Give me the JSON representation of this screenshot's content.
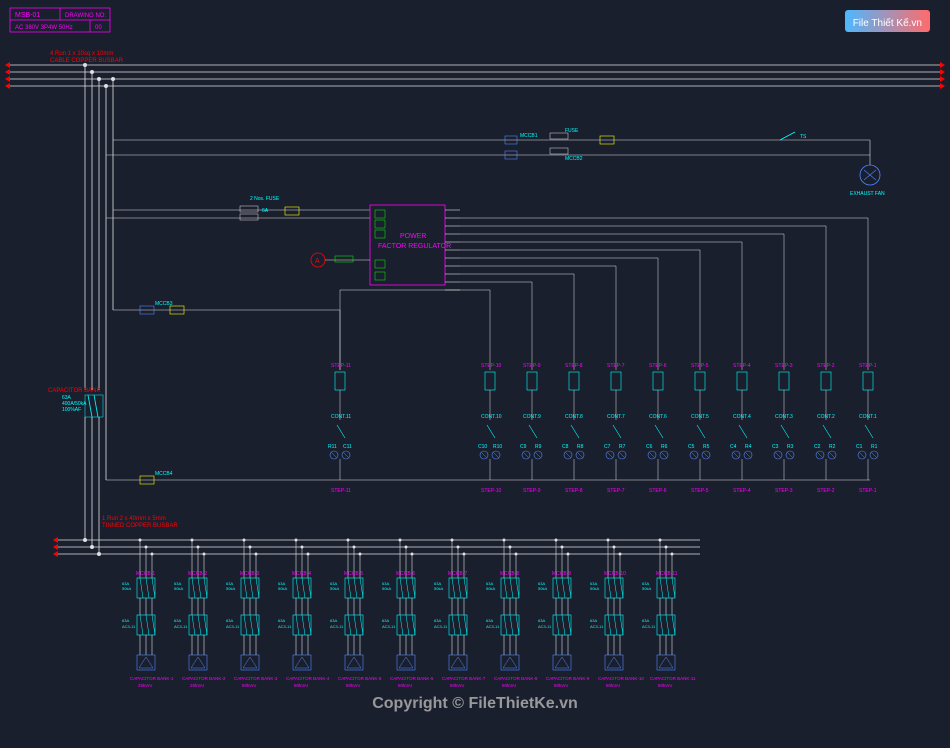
{
  "logo": {
    "main": "File Thiết Kế",
    "suffix": ".vn"
  },
  "copyright": "Copyright © FileThietKe.vn",
  "titleBlock": {
    "name": "MSB-01",
    "drawing": "DRAWING NO:",
    "spec": "AC 380V 3P4W 50Hz",
    "rev": "00"
  },
  "busLabels": {
    "top": "4 Run 1 x 10sq x 10mm",
    "topSub": "CABLE COPPER BUSBAR",
    "bottom": "1 Run 2 x 40mm x 5mm",
    "bottomSub": "TINNED COPPER BUSBAR"
  },
  "mainBreaker": {
    "label": "CAPACITOR BANK",
    "rating1": "63A",
    "rating2": "400A/50kA",
    "rating3": "100%AF"
  },
  "pfr": {
    "title1": "POWER",
    "title2": "FACTOR REGULATOR",
    "fuseLabel": "2 Nos. FUSE",
    "fuseRating": "6A"
  },
  "auxDevices": {
    "mccb1": "MCCB1",
    "mccb2": "MCCB2",
    "mccb3": "MCCB3",
    "mccb4": "MCCB4",
    "fuse": "FUSE",
    "exhaustFan": "EXHAUST FAN",
    "ts": "TS"
  },
  "capacitorSteps": [
    {
      "id": "step-11",
      "step": "STEP-11",
      "cont": "CONT.11",
      "r": "R11",
      "c": "C11"
    },
    {
      "id": "step-10",
      "step": "STEP-10",
      "cont": "CONT.10",
      "r": "C10",
      "c": "R10"
    },
    {
      "id": "step-9",
      "step": "STEP-9",
      "cont": "CONT.9",
      "r": "C9",
      "c": "R9"
    },
    {
      "id": "step-8",
      "step": "STEP-8",
      "cont": "CONT.8",
      "r": "C8",
      "c": "R8"
    },
    {
      "id": "step-7",
      "step": "STEP-7",
      "cont": "CONT.7",
      "r": "C7",
      "c": "R7"
    },
    {
      "id": "step-6",
      "step": "STEP-6",
      "cont": "CONT.6",
      "r": "C6",
      "c": "R6"
    },
    {
      "id": "step-5",
      "step": "STEP-5",
      "cont": "CONT.5",
      "r": "C5",
      "c": "R5"
    },
    {
      "id": "step-4",
      "step": "STEP-4",
      "cont": "CONT.4",
      "r": "C4",
      "c": "R4"
    },
    {
      "id": "step-3",
      "step": "STEP-3",
      "cont": "CONT.3",
      "r": "C3",
      "c": "R3"
    },
    {
      "id": "step-2",
      "step": "STEP-2",
      "cont": "CONT.2",
      "r": "C2",
      "c": "R2"
    },
    {
      "id": "step-1",
      "step": "STEP-1",
      "cont": "CONT.1",
      "r": "C1",
      "c": "R1"
    }
  ],
  "banks": [
    {
      "id": "bank-1",
      "mccb": "MCCB-1",
      "label": "CAPACITOR BANK-1",
      "rating": "25kVAr"
    },
    {
      "id": "bank-2",
      "mccb": "MCCB-2",
      "label": "CAPACITOR BANK-2",
      "rating": "25kVAr"
    },
    {
      "id": "bank-3",
      "mccb": "MCCB-3",
      "label": "CAPACITOR BANK-3",
      "rating": "50kVAr"
    },
    {
      "id": "bank-4",
      "mccb": "MCCB-4",
      "label": "CAPACITOR BANK-4",
      "rating": "50kVAr"
    },
    {
      "id": "bank-5",
      "mccb": "MCCB-5",
      "label": "CAPACITOR BANK-5",
      "rating": "50kVAr"
    },
    {
      "id": "bank-6",
      "mccb": "MCCB-6",
      "label": "CAPACITOR BANK-6",
      "rating": "50kVAr"
    },
    {
      "id": "bank-7",
      "mccb": "MCCB-7",
      "label": "CAPACITOR BANK-7",
      "rating": "50kVAr"
    },
    {
      "id": "bank-8",
      "mccb": "MCCB-8",
      "label": "CAPACITOR BANK-8",
      "rating": "50kVAr"
    },
    {
      "id": "bank-9",
      "mccb": "MCCB-9",
      "label": "CAPACITOR BANK-9",
      "rating": "50kVAr"
    },
    {
      "id": "bank-10",
      "mccb": "MCCB-10",
      "label": "CAPACITOR BANK-10",
      "rating": "50kVAr"
    },
    {
      "id": "bank-11",
      "mccb": "MCCB-11",
      "label": "CAPACITOR BANK-11",
      "rating": "50kVAr"
    }
  ],
  "colors": {
    "magenta": "#ff00ff",
    "cyan": "#00ffff",
    "red": "#ff0000",
    "yellow": "#ffff00",
    "green": "#00ff00",
    "blue": "#4d88ff",
    "white": "#e0e0e0"
  }
}
